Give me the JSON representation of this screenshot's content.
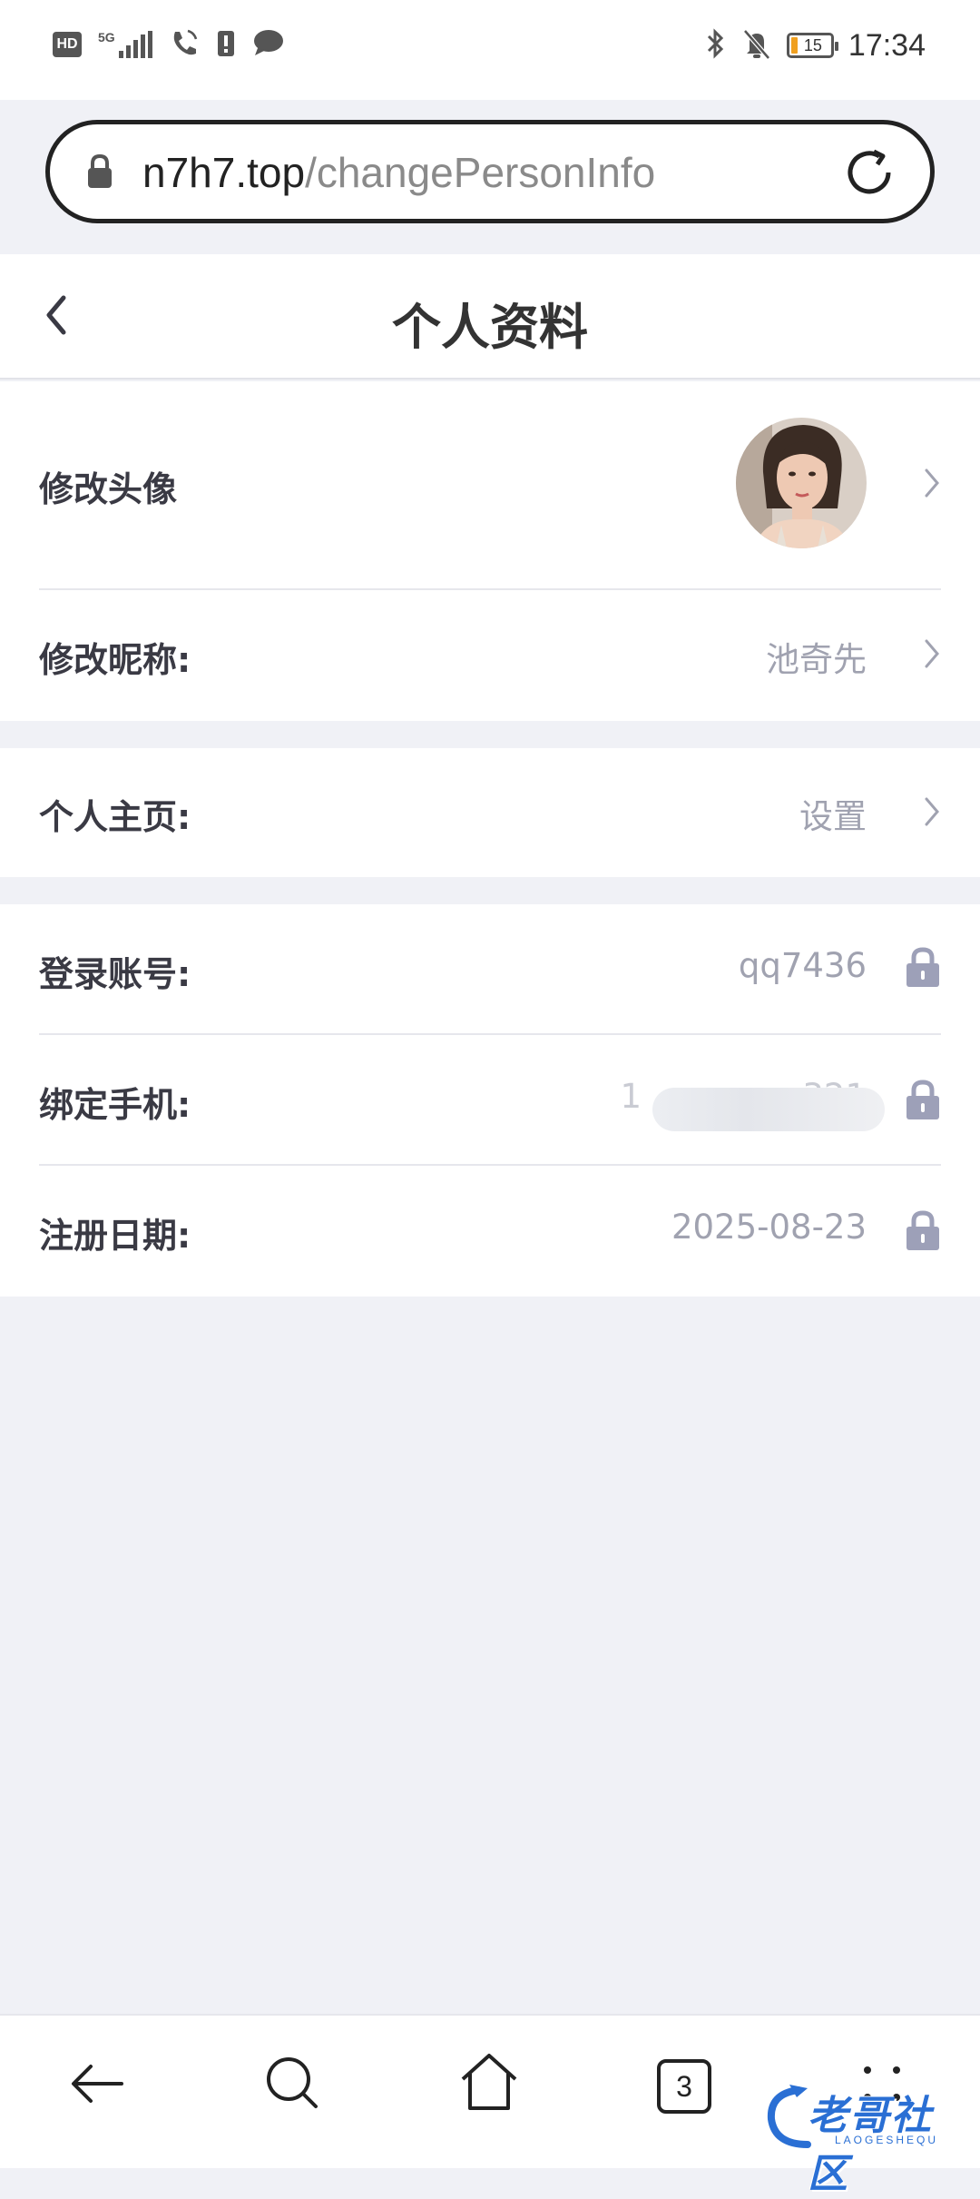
{
  "status_bar": {
    "hd_label": "HD",
    "network_label": "5G",
    "battery_level": "15",
    "time": "17:34",
    "icons": [
      "signal-icon",
      "wifi-calling-icon",
      "sim-alert-icon",
      "message-icon",
      "bluetooth-icon",
      "mute-icon",
      "battery-icon"
    ]
  },
  "url_bar": {
    "domain": "n7h7.top",
    "path": "/changePersonInfo",
    "icons": [
      "lock-icon",
      "reload-icon"
    ]
  },
  "header": {
    "title": "个人资料",
    "back_icon": "chevron-left-icon"
  },
  "profile": {
    "avatar_row": {
      "label": "修改头像"
    },
    "nickname_row": {
      "label": "修改昵称:",
      "value": "池奇先"
    },
    "homepage_row": {
      "label": "个人主页:",
      "value": "设置"
    },
    "account_row": {
      "label": "登录账号:",
      "value": "qq7436"
    },
    "phone_row": {
      "label": "绑定手机:",
      "value_start": "1",
      "value_end": "321"
    },
    "register_row": {
      "label": "注册日期:",
      "value": "2025-08-23"
    }
  },
  "bottom_nav": {
    "tab_count": "3",
    "icons": [
      "back-arrow-icon",
      "search-icon",
      "home-icon",
      "tabs-icon",
      "more-icon"
    ]
  },
  "watermark": {
    "text": "老哥社区",
    "sub": "LAOGESHEQU"
  },
  "colors": {
    "background": "#f0f1f6",
    "label": "#3a3a44",
    "value": "#a0a2b0",
    "lock": "#9da0b8",
    "battery_fill": "#f0a020",
    "watermark": "#2a6fd4"
  }
}
